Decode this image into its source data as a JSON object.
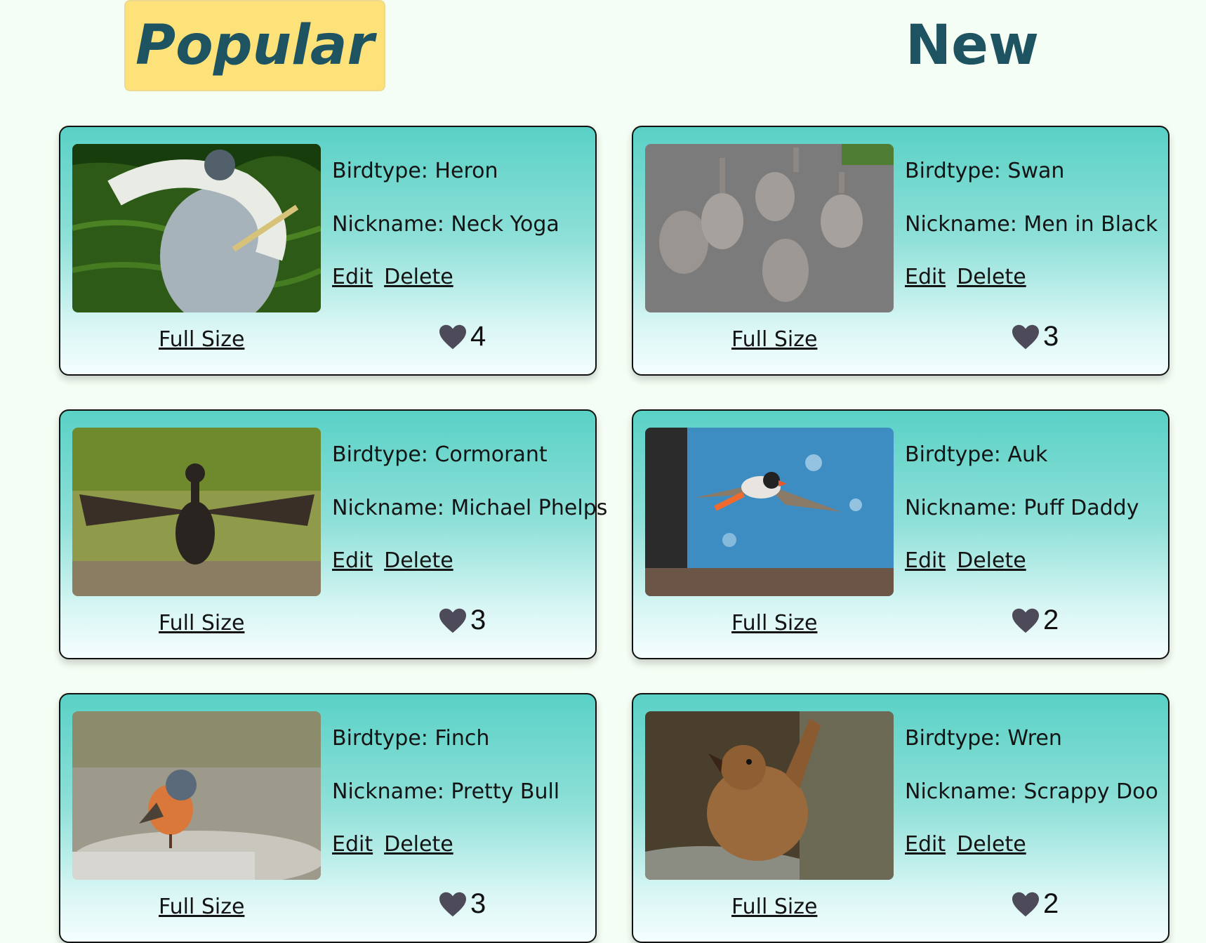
{
  "tabs": {
    "popular": "Popular",
    "new": "New"
  },
  "colors": {
    "tab_active_bg": "#fde27a",
    "tab_text": "#1e5462",
    "card_top": "#5ad1c6",
    "card_bottom": "#f4fefe",
    "heart": "#4d4a5a"
  },
  "cards": [
    {
      "birdtype": "Birdtype: Heron",
      "nickname": "Nickname: Neck Yoga",
      "edit": "Edit",
      "delete": "Delete",
      "full_size": "Full Size",
      "likes": "4",
      "icon": "heart-icon"
    },
    {
      "birdtype": "Birdtype: Swan",
      "nickname": "Nickname: Men in Black",
      "edit": "Edit",
      "delete": "Delete",
      "full_size": "Full Size",
      "likes": "3",
      "icon": "heart-icon"
    },
    {
      "birdtype": "Birdtype: Cormorant",
      "nickname": "Nickname: Michael Phelps",
      "edit": "Edit",
      "delete": "Delete",
      "full_size": "Full Size",
      "likes": "3",
      "icon": "heart-icon"
    },
    {
      "birdtype": "Birdtype: Auk",
      "nickname": "Nickname: Puff Daddy",
      "edit": "Edit",
      "delete": "Delete",
      "full_size": "Full Size",
      "likes": "2",
      "icon": "heart-icon"
    },
    {
      "birdtype": "Birdtype: Finch",
      "nickname": "Nickname: Pretty Bull",
      "edit": "Edit",
      "delete": "Delete",
      "full_size": "Full Size",
      "likes": "3",
      "icon": "heart-icon"
    },
    {
      "birdtype": "Birdtype: Wren",
      "nickname": "Nickname: Scrappy Doo",
      "edit": "Edit",
      "delete": "Delete",
      "full_size": "Full Size",
      "likes": "2",
      "icon": "heart-icon"
    }
  ]
}
